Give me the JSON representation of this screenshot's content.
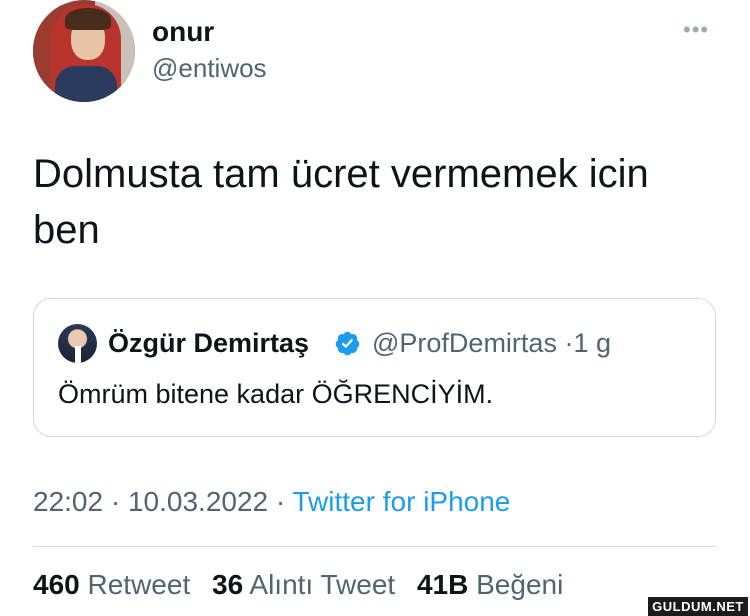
{
  "author": {
    "name": "onur",
    "handle": "@entiwos"
  },
  "more_icon": "ellipsis-icon",
  "tweet": {
    "text": "Dolmusta tam ücret vermemek icin ben"
  },
  "quote": {
    "author_name": "Özgür Demirtaş",
    "verified_icon": "verified-badge-icon",
    "verified_color": "#1d9bf0",
    "handle": "@ProfDemirtas",
    "separator": "·",
    "age": "1 g",
    "text": "Ömrüm bitene kadar ÖĞRENCİYİM."
  },
  "meta": {
    "time": "22:02",
    "sep1": "·",
    "date": "10.03.2022",
    "sep2": "·",
    "source": "Twitter for iPhone"
  },
  "stats": {
    "retweets": "460",
    "retweets_label": "Retweet",
    "quotes": "36",
    "quotes_label": "Alıntı Tweet",
    "likes": "41B",
    "likes_label": "Beğeni"
  },
  "watermark": "GULDUM.NET",
  "colors": {
    "accent": "#1d9bf0",
    "secondary_text": "#536471",
    "primary_text": "#0f1419",
    "border": "#cfd9de"
  }
}
